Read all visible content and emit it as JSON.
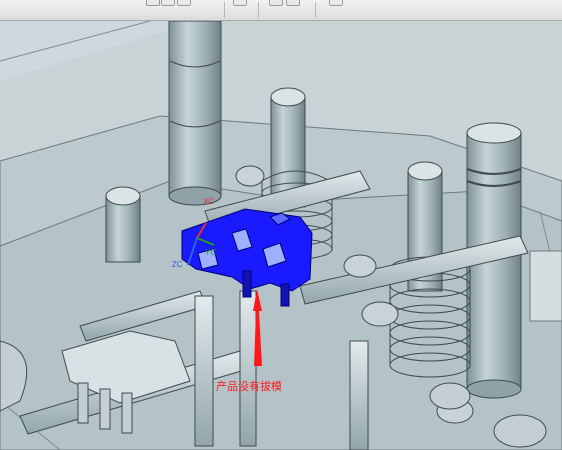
{
  "toolbar": {
    "buttons": [
      "view-orient",
      "fit",
      "render-style",
      "section",
      "layers",
      "snap"
    ]
  },
  "viewport": {
    "annotation": "产品没有拔模",
    "csys_labels": {
      "xc": "XC",
      "zc": "ZC",
      "yc": "YC"
    },
    "colors": {
      "background": "#cfd8dc",
      "part": "#1a1aff",
      "arrow": "#ff1a1a",
      "mold": "#b9c9ce",
      "edge": "#4a5559"
    }
  }
}
